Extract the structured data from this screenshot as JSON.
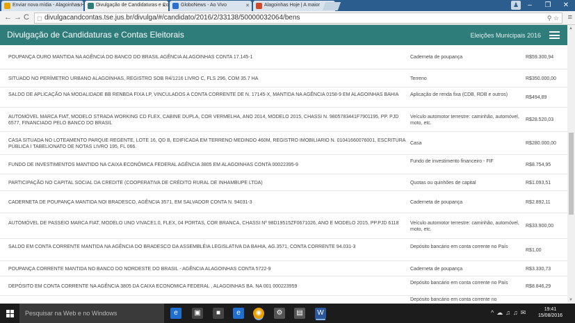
{
  "browser": {
    "tabs": [
      {
        "label": "Enviar nova mídia - Alagoinhas Hoje",
        "color": "#e5a400",
        "active": false
      },
      {
        "label": "Divulgação de Candidaturas e Contas",
        "color": "#2e7d7b",
        "active": true
      },
      {
        "label": "GloboNews - Ao Vivo",
        "color": "#2a6fd0",
        "active": false
      },
      {
        "label": "Alagoinhas Hoje | A maior",
        "color": "#d04a2a",
        "active": false
      }
    ],
    "url": "divulgacandcontas.tse.jus.br/divulga/#/candidato/2016/2/33138/50000032064/bens",
    "user_icon": "person-icon"
  },
  "header": {
    "title": "Divulgação de Candidaturas e Contas Eleitorais",
    "election": "Eleições Municipais 2016"
  },
  "rows": [
    {
      "desc": "POUPANÇA OURO MANTIDA NA AGÊNCIA DO BANCO DO BRASIL AGÊNCIA ALAGOINHAS CONTA 17.145-1",
      "kind": "Caderneta de poupança",
      "value": "R$59.300,94"
    },
    {
      "desc": "SITUADO NO PERÍMETRO URBANO ALAGOINHAS, REGISTRO SOB R4/1216 LIVRO C, FLS 296, COM 35.7 HA",
      "kind": "Terreno",
      "value": "R$350.000,00"
    },
    {
      "desc": "SALDO DE APLICAÇÃO NA MODALIDADE BB RENBDA FIXA LP, VINCULADOS A CONTA CORRENTE DE N. 17145-X, MANTIDA NA AGÊNCIA 0158-9 EM ALAGOINHAS BAHIA",
      "kind": "Aplicação de renda fixa (CDB, RDB e outros)",
      "value": "R$494,89"
    },
    {
      "desc": "AUTOMÓVEL MARCA FIAT, MODELO STRADA WORKING CD FLEX, CABINE DUPLA, COR VERMELHA, ANO 2014, MODELO 2015, CHASSI N. 9805783441F7901195, PP. PJD 6577, FINANCIADO PELO BANCO DO BRASIL",
      "kind": "Veículo automotor terrestre: caminhão, automóvel, moto, etc.",
      "value": "R$28.520,03"
    },
    {
      "desc": "CASA SITUADA NO LOTEAMENTO PARQUE REGENTE, LOTE 16, QD B, EDIFICADA EM TERRENO MEDINDO 460M, REGISTRO IMOBILIARIO N. 01041660076001, ESCRITURA PÚBLICA I TABELIONATO DE NOTAS LIVRO 195, FL 066.",
      "kind": "Casa",
      "value": "R$280.000,00"
    },
    {
      "desc": "FUNDO DE INVESTIMENTOS MANTIDO NA CAIXA ECONÔMICA FEDERAL AGÊNCIA 3805 EM ALAGOINHAS CONTA 00022395-9",
      "kind": "Fundo de investimento financeiro - FIF",
      "value": "R$8.754,95"
    },
    {
      "desc": "PARTICIPAÇÃO NO CAPITAL SOCIAL DA CREDITE (COOPERATIVA DE CRÉDITO RURAL DE INHAMBUPE LTDA)",
      "kind": "Quotas ou quinhões de capital",
      "value": "R$1.093,51"
    },
    {
      "desc": "CADERNETA DE POUPANÇA MANTIDA NOI BRADESCO, AGÊNCIA 3571, EM SALVADOR CONTA N. 94031-3",
      "kind": "Caderneta de poupança",
      "value": "R$2.892,11"
    },
    {
      "desc": "AUTOMÓVEL DE PASSEIO MARCA FIAT, MODELO UNO VIVACE1.0, FLEX, 04 PORTAS, COR BRANCA, CHASSI Nº 98D19515ZF0671026, ANO E MODELO 2015, PP.PJD 6118",
      "kind": "Veículo automotor terrestre: caminhão, automóvel, moto, etc.",
      "value": "R$33.900,00"
    },
    {
      "desc": "SALDO EM CONTA CORRENTE MANTIDA NA AGÊNCIA DO BRADESCO DA ASSEMBLÉIA LEGISLATIVA DA BAHIA, AG.3571, CONTA CORRENTE 94.031-3",
      "kind": "Depósito bancário em conta corrente no País",
      "value": "R$1,00"
    },
    {
      "desc": "POUPANÇA CORRENTE MANTIDA NO BANCO DO NORDESTE DO BRASIL - AGÊNCIA ALAGOINHAS CONTA 5722-9",
      "kind": "Caderneta de poupança",
      "value": "R$3.330,73"
    },
    {
      "desc": "DEPÓSITO EM CONTA CORRENTE NA AGÊNCIA 3805 DA CAIXA ECONOMICA FEDERAL , ALAGOINHAS BA. NA 001 000223959",
      "kind": "Depósito bancário em conta corrente no País",
      "value": "R$8.846,29"
    },
    {
      "desc": "",
      "kind": "Depósito bancário em conta corrente no",
      "value": ""
    }
  ],
  "taskbar": {
    "search_placeholder": "Pesquisar na Web e no Windows",
    "time": "19:41",
    "date": "15/08/2016"
  }
}
